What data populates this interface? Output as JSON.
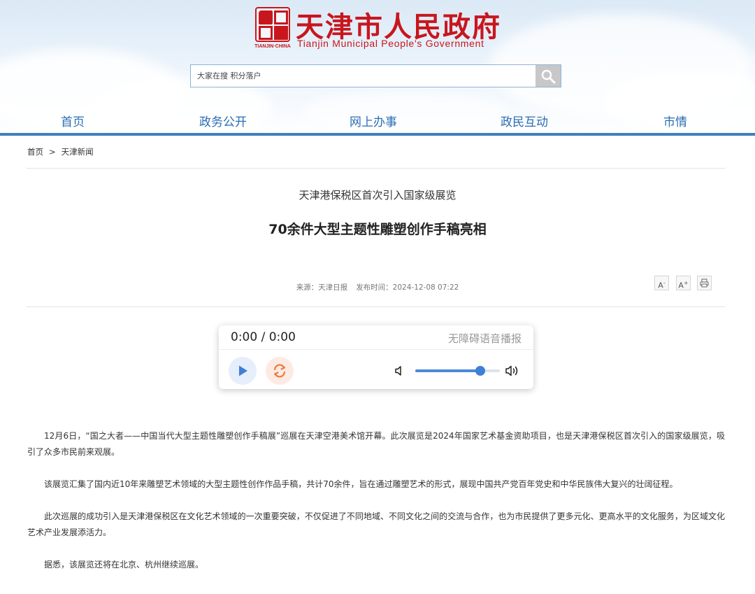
{
  "header": {
    "logo_cn": "天津市人民政府",
    "logo_en": "Tianjin Municipal People's Government",
    "logo_mark_label": "TIANJIN·CHINA",
    "brand_color": "#c8161d",
    "nav_color": "#2b6db3"
  },
  "search": {
    "placeholder": "大家在搜 积分落户",
    "icon": "search-icon"
  },
  "nav": {
    "items": [
      "首页",
      "政务公开",
      "网上办事",
      "政民互动",
      "市情"
    ]
  },
  "breadcrumb": {
    "home": "首页",
    "separator": ">",
    "current": "天津新闻"
  },
  "article": {
    "subtitle": "天津港保税区首次引入国家级展览",
    "title": "70余件大型主题性雕塑创作手稿亮相",
    "source": "来源：天津日报",
    "published": "发布时间：2024-12-08 07:22",
    "paragraphs": [
      "12月6日，“国之大者——中国当代大型主题性雕塑创作手稿展”巡展在天津空港美术馆开幕。此次展览是2024年国家艺术基金资助项目，也是天津港保税区首次引入的国家级展览，吸引了众多市民前来观展。",
      "该展览汇集了国内近10年来雕塑艺术领域的大型主题性创作作品手稿，共计70余件，旨在通过雕塑艺术的形式，展现中国共产党百年党史和中华民族伟大复兴的壮阔征程。",
      "此次巡展的成功引入是天津港保税区在文化艺术领域的一次重要突破，不仅促进了不同地域、不同文化之间的交流与合作，也为市民提供了更多元化、更高水平的文化服务，为区域文化艺术产业发展添活力。",
      "据悉，该展览还将在北京、杭州继续巡展。"
    ]
  },
  "tools": {
    "font_smaller": "A",
    "font_smaller_sup": "-",
    "font_larger": "A",
    "font_larger_sup": "+",
    "print_icon": "print-icon"
  },
  "player": {
    "time": "0:00 / 0:00",
    "label": "无障碍语音播报",
    "volume": 0.77,
    "play_icon": "play-icon",
    "loop_icon": "loop-icon",
    "accent": "#4a8ad9"
  }
}
